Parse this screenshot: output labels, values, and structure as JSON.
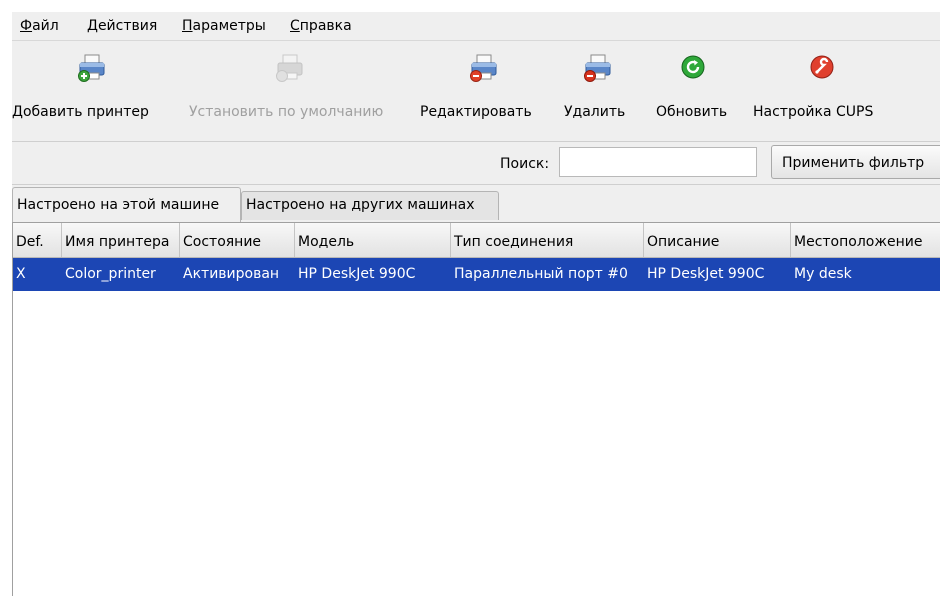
{
  "menubar": {
    "items": [
      {
        "accel": "Ф",
        "rest": "айл"
      },
      {
        "accel": "Д",
        "rest": "ействия"
      },
      {
        "accel": "П",
        "rest": "араметры"
      },
      {
        "accel": "С",
        "rest": "правка"
      }
    ]
  },
  "toolbar": {
    "buttons": [
      {
        "label": "Добавить принтер",
        "icon": "printer-add-icon",
        "enabled": true
      },
      {
        "label": "Установить по умолчанию",
        "icon": "printer-default-icon",
        "enabled": false
      },
      {
        "label": "Редактировать",
        "icon": "printer-edit-icon",
        "enabled": true
      },
      {
        "label": "Удалить",
        "icon": "printer-delete-icon",
        "enabled": true
      },
      {
        "label": "Обновить",
        "icon": "refresh-icon",
        "enabled": true
      },
      {
        "label": "Настройка CUPS",
        "icon": "cups-settings-icon",
        "enabled": true
      }
    ]
  },
  "search": {
    "label": "Поиск:",
    "value": "",
    "placeholder": "",
    "filter_button": "Применить фильтр"
  },
  "tabs": [
    {
      "label": "Настроено на этой машине",
      "active": true
    },
    {
      "label": "Настроено на других машинах",
      "active": false
    }
  ],
  "table": {
    "columns": [
      "Def.",
      "Имя принтера",
      "Состояние",
      "Модель",
      "Тип соединения",
      "Описание",
      "Местоположение"
    ],
    "rows": [
      [
        "X",
        "Color_printer",
        "Активирован",
        "HP DeskJet 990C",
        "Параллельный порт #0",
        "HP DeskJet 990C",
        "My desk"
      ]
    ],
    "selected_row": 0
  },
  "colors": {
    "selection": "#1c46b4",
    "window_bg": "#efefef"
  }
}
